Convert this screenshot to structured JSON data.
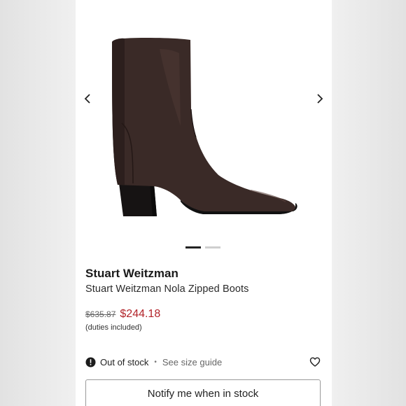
{
  "product": {
    "brand": "Stuart Weitzman",
    "name": "Stuart Weitzman Nola Zipped Boots",
    "original_price": "$635.87",
    "sale_price": "$244.18",
    "duties_note": "(duties included)",
    "image_icon": "ankle-boot-photo"
  },
  "gallery": {
    "prev_icon": "chevron-left-icon",
    "next_icon": "chevron-right-icon",
    "image_count": 2,
    "active_index": 0
  },
  "availability": {
    "status": "Out of stock",
    "separator": "•",
    "size_guide_label": "See size guide",
    "status_icon": "alert-circle-icon",
    "wishlist_icon": "heart-icon"
  },
  "actions": {
    "notify_label": "Notify me when in stock"
  },
  "colors": {
    "sale_price": "#b2242a",
    "boot_leather": "#3a2a27",
    "active_dot": "#222222"
  }
}
